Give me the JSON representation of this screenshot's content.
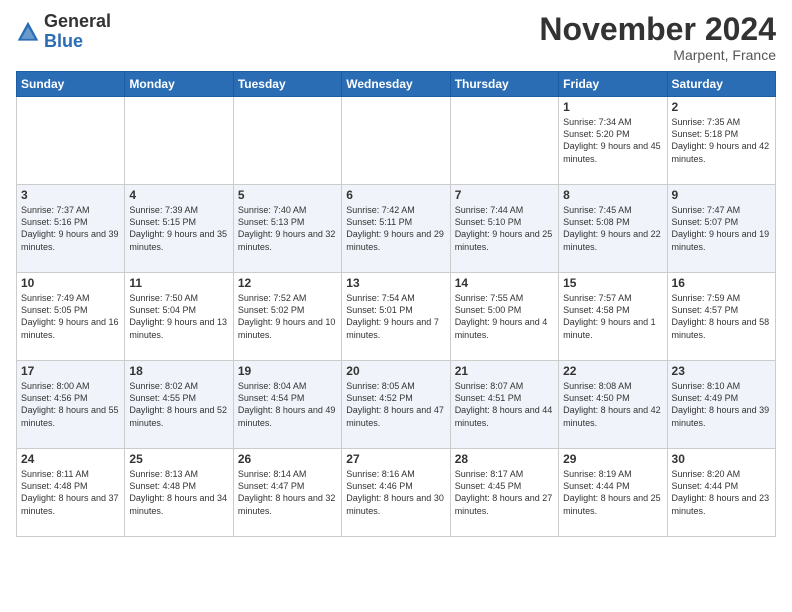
{
  "header": {
    "logo_general": "General",
    "logo_blue": "Blue",
    "month_title": "November 2024",
    "location": "Marpent, France"
  },
  "days_of_week": [
    "Sunday",
    "Monday",
    "Tuesday",
    "Wednesday",
    "Thursday",
    "Friday",
    "Saturday"
  ],
  "weeks": [
    [
      {
        "day": "",
        "info": ""
      },
      {
        "day": "",
        "info": ""
      },
      {
        "day": "",
        "info": ""
      },
      {
        "day": "",
        "info": ""
      },
      {
        "day": "",
        "info": ""
      },
      {
        "day": "1",
        "info": "Sunrise: 7:34 AM\nSunset: 5:20 PM\nDaylight: 9 hours\nand 45 minutes."
      },
      {
        "day": "2",
        "info": "Sunrise: 7:35 AM\nSunset: 5:18 PM\nDaylight: 9 hours\nand 42 minutes."
      }
    ],
    [
      {
        "day": "3",
        "info": "Sunrise: 7:37 AM\nSunset: 5:16 PM\nDaylight: 9 hours\nand 39 minutes."
      },
      {
        "day": "4",
        "info": "Sunrise: 7:39 AM\nSunset: 5:15 PM\nDaylight: 9 hours\nand 35 minutes."
      },
      {
        "day": "5",
        "info": "Sunrise: 7:40 AM\nSunset: 5:13 PM\nDaylight: 9 hours\nand 32 minutes."
      },
      {
        "day": "6",
        "info": "Sunrise: 7:42 AM\nSunset: 5:11 PM\nDaylight: 9 hours\nand 29 minutes."
      },
      {
        "day": "7",
        "info": "Sunrise: 7:44 AM\nSunset: 5:10 PM\nDaylight: 9 hours\nand 25 minutes."
      },
      {
        "day": "8",
        "info": "Sunrise: 7:45 AM\nSunset: 5:08 PM\nDaylight: 9 hours\nand 22 minutes."
      },
      {
        "day": "9",
        "info": "Sunrise: 7:47 AM\nSunset: 5:07 PM\nDaylight: 9 hours\nand 19 minutes."
      }
    ],
    [
      {
        "day": "10",
        "info": "Sunrise: 7:49 AM\nSunset: 5:05 PM\nDaylight: 9 hours\nand 16 minutes."
      },
      {
        "day": "11",
        "info": "Sunrise: 7:50 AM\nSunset: 5:04 PM\nDaylight: 9 hours\nand 13 minutes."
      },
      {
        "day": "12",
        "info": "Sunrise: 7:52 AM\nSunset: 5:02 PM\nDaylight: 9 hours\nand 10 minutes."
      },
      {
        "day": "13",
        "info": "Sunrise: 7:54 AM\nSunset: 5:01 PM\nDaylight: 9 hours\nand 7 minutes."
      },
      {
        "day": "14",
        "info": "Sunrise: 7:55 AM\nSunset: 5:00 PM\nDaylight: 9 hours\nand 4 minutes."
      },
      {
        "day": "15",
        "info": "Sunrise: 7:57 AM\nSunset: 4:58 PM\nDaylight: 9 hours\nand 1 minute."
      },
      {
        "day": "16",
        "info": "Sunrise: 7:59 AM\nSunset: 4:57 PM\nDaylight: 8 hours\nand 58 minutes."
      }
    ],
    [
      {
        "day": "17",
        "info": "Sunrise: 8:00 AM\nSunset: 4:56 PM\nDaylight: 8 hours\nand 55 minutes."
      },
      {
        "day": "18",
        "info": "Sunrise: 8:02 AM\nSunset: 4:55 PM\nDaylight: 8 hours\nand 52 minutes."
      },
      {
        "day": "19",
        "info": "Sunrise: 8:04 AM\nSunset: 4:54 PM\nDaylight: 8 hours\nand 49 minutes."
      },
      {
        "day": "20",
        "info": "Sunrise: 8:05 AM\nSunset: 4:52 PM\nDaylight: 8 hours\nand 47 minutes."
      },
      {
        "day": "21",
        "info": "Sunrise: 8:07 AM\nSunset: 4:51 PM\nDaylight: 8 hours\nand 44 minutes."
      },
      {
        "day": "22",
        "info": "Sunrise: 8:08 AM\nSunset: 4:50 PM\nDaylight: 8 hours\nand 42 minutes."
      },
      {
        "day": "23",
        "info": "Sunrise: 8:10 AM\nSunset: 4:49 PM\nDaylight: 8 hours\nand 39 minutes."
      }
    ],
    [
      {
        "day": "24",
        "info": "Sunrise: 8:11 AM\nSunset: 4:48 PM\nDaylight: 8 hours\nand 37 minutes."
      },
      {
        "day": "25",
        "info": "Sunrise: 8:13 AM\nSunset: 4:48 PM\nDaylight: 8 hours\nand 34 minutes."
      },
      {
        "day": "26",
        "info": "Sunrise: 8:14 AM\nSunset: 4:47 PM\nDaylight: 8 hours\nand 32 minutes."
      },
      {
        "day": "27",
        "info": "Sunrise: 8:16 AM\nSunset: 4:46 PM\nDaylight: 8 hours\nand 30 minutes."
      },
      {
        "day": "28",
        "info": "Sunrise: 8:17 AM\nSunset: 4:45 PM\nDaylight: 8 hours\nand 27 minutes."
      },
      {
        "day": "29",
        "info": "Sunrise: 8:19 AM\nSunset: 4:44 PM\nDaylight: 8 hours\nand 25 minutes."
      },
      {
        "day": "30",
        "info": "Sunrise: 8:20 AM\nSunset: 4:44 PM\nDaylight: 8 hours\nand 23 minutes."
      }
    ]
  ]
}
